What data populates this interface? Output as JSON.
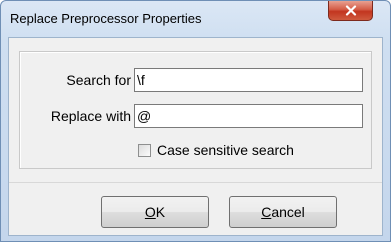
{
  "window": {
    "title": "Replace Preprocessor Properties"
  },
  "form": {
    "search_label": "Search for",
    "search_value": "\\f",
    "replace_label": "Replace with",
    "replace_value": "@",
    "case_sensitive_label": "Case sensitive search",
    "case_sensitive_checked": false
  },
  "buttons": {
    "ok_mnemonic": "O",
    "ok_rest": "K",
    "cancel_mnemonic": "C",
    "cancel_rest": "ancel"
  },
  "icons": {
    "close": "close-icon",
    "checkbox": "checkbox-icon"
  },
  "colors": {
    "close_button": "#c2351f",
    "titlebar": "#dbe7f5",
    "client_bg": "#f0f0f0"
  }
}
